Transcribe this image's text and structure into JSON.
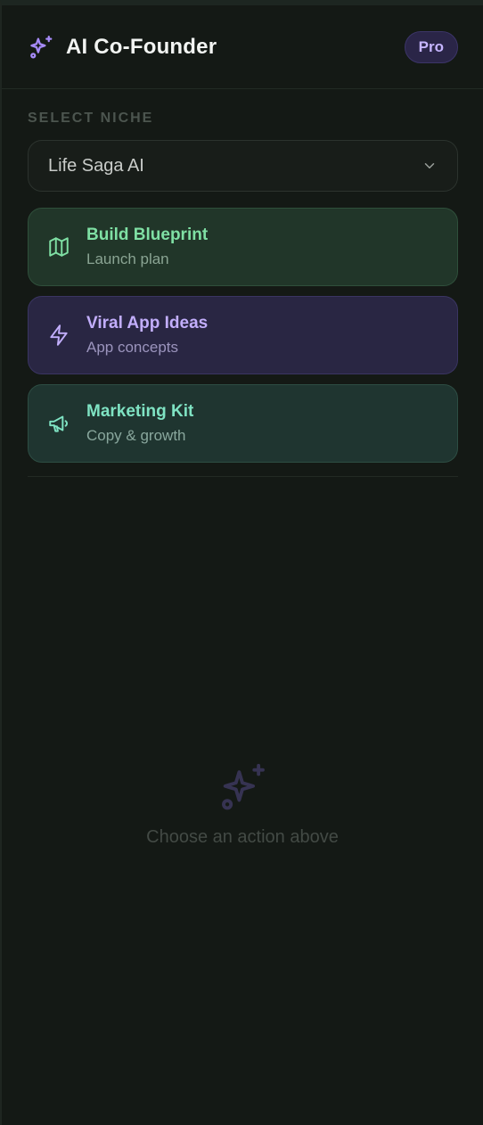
{
  "header": {
    "title": "AI Co-Founder",
    "badge": "Pro",
    "icon": "sparkles-icon"
  },
  "niche": {
    "label": "SELECT NICHE",
    "selected": "Life Saga AI"
  },
  "actions": [
    {
      "title": "Build Blueprint",
      "subtitle": "Launch plan",
      "icon": "map-icon",
      "accent": "#7fe0a4"
    },
    {
      "title": "Viral App Ideas",
      "subtitle": "App concepts",
      "icon": "zap-icon",
      "accent": "#c2aefc"
    },
    {
      "title": "Marketing Kit",
      "subtitle": "Copy & growth",
      "icon": "megaphone-icon",
      "accent": "#7fe3c3"
    }
  ],
  "empty_state": {
    "message": "Choose an action above",
    "icon": "sparkles-icon"
  },
  "colors": {
    "background": "#141915",
    "brand_accent": "#a78bfa"
  }
}
